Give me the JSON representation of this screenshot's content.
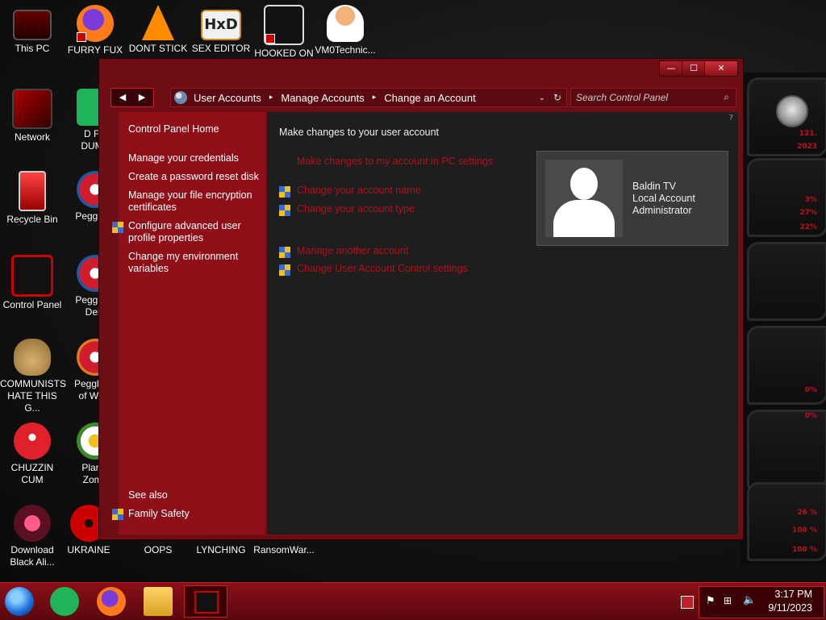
{
  "desktop": {
    "icons": [
      {
        "label": "This PC"
      },
      {
        "label": "FURRY FUX"
      },
      {
        "label": "DONT STICK"
      },
      {
        "label": "SEX EDITOR"
      },
      {
        "label": "HOOKED ON"
      },
      {
        "label": "VM0Technic..."
      },
      {
        "label": "Network"
      },
      {
        "label": "D FC\nDUMB"
      },
      {
        "label": "Recycle Bin"
      },
      {
        "label": "Peggle D"
      },
      {
        "label": "Control Panel"
      },
      {
        "label": "Peggle N\nDelu"
      },
      {
        "label": "COMMUNISTS\nHATE THIS G..."
      },
      {
        "label": "Peggle W\nof Warc"
      },
      {
        "label": "CHUZZIN\nCUM"
      },
      {
        "label": "Plants\nZomb"
      },
      {
        "label": "Download\nBlack Ali..."
      },
      {
        "label": "UKRAINE"
      },
      {
        "label": "OOPS"
      },
      {
        "label": "LYNCHING"
      },
      {
        "label": "RansomWar..."
      }
    ]
  },
  "widget": {
    "labels": [
      "121.",
      "2023",
      "3%",
      "27%",
      "22%",
      "0%",
      "0%",
      "26 %",
      "100 %",
      "100 %"
    ]
  },
  "window": {
    "caption": {
      "minimize": "—",
      "maximize": "☐",
      "close": "✕"
    },
    "nav": {
      "back": "◀",
      "forward": "▶"
    },
    "breadcrumb": [
      "User Accounts",
      "Manage Accounts",
      "Change an Account"
    ],
    "search_placeholder": "Search Control Panel",
    "sidebar": {
      "home": "Control Panel Home",
      "links": [
        "Manage your credentials",
        "Create a password reset disk",
        "Manage your file encryption certificates",
        "Configure advanced user profile properties",
        "Change my environment variables"
      ],
      "see_also": "See also",
      "family_safety": "Family Safety"
    },
    "main": {
      "heading": "Make changes to your user account",
      "pc_settings_link": "Make changes to my account in PC settings",
      "links": [
        "Change your account name",
        "Change your account type",
        "Manage another account",
        "Change User Account Control settings"
      ],
      "user": {
        "name": "Baldin TV",
        "type": "Local Account",
        "role": "Administrator"
      }
    }
  },
  "taskbar": {
    "time": "3:17 PM",
    "date": "9/11/2023"
  },
  "colors": {
    "accent": "#8e0f18",
    "link": "#b4101a",
    "main_bg": "#1e1e1e"
  }
}
